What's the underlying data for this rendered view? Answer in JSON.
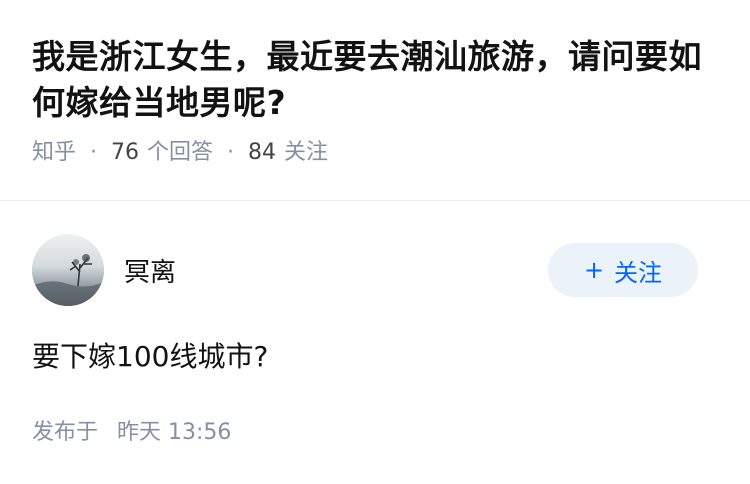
{
  "question": {
    "title": "我是浙江女生，最近要去潮汕旅游，请问要如何嫁给当地男呢?",
    "source": "知乎",
    "answer_count": "76",
    "answer_label": "个回答",
    "follow_count": "84",
    "follow_label": "关注"
  },
  "answer": {
    "author_name": "冥离",
    "follow_button": "关注",
    "follow_icon": "plus-icon",
    "content": "要下嫁100线城市?",
    "published_label": "发布于",
    "published_time": "昨天 13:56"
  },
  "colors": {
    "accent": "#0066ff",
    "follow_button_bg": "#ebf2fa",
    "meta_text": "#8590a6"
  }
}
